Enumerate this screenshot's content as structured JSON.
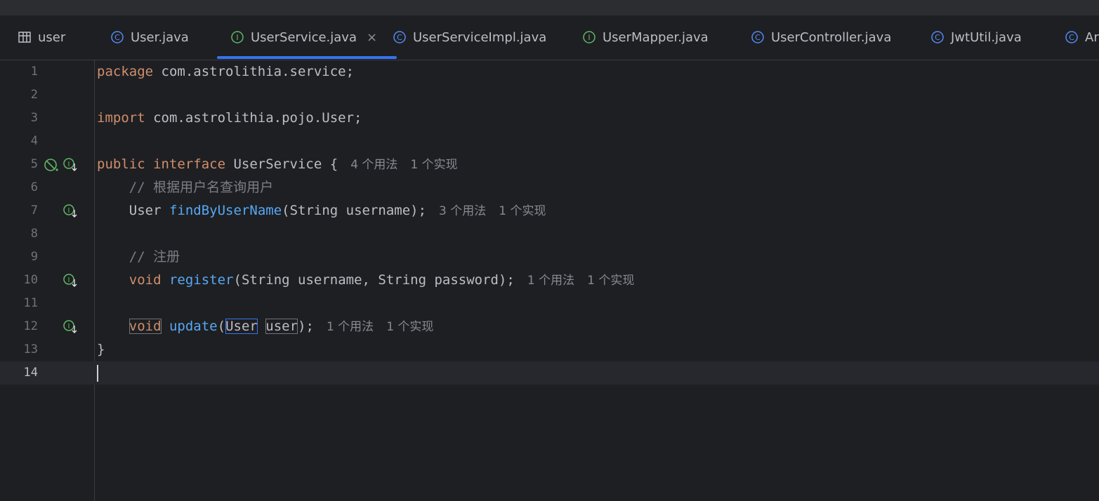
{
  "tabs": [
    {
      "label": "user",
      "icon": "table-icon",
      "active": false
    },
    {
      "label": "User.java",
      "icon": "class-icon",
      "active": false
    },
    {
      "label": "UserService.java",
      "icon": "interface-icon",
      "active": true
    },
    {
      "label": "UserServiceImpl.java",
      "icon": "class-icon",
      "active": false
    },
    {
      "label": "UserMapper.java",
      "icon": "interface-icon",
      "active": false
    },
    {
      "label": "UserController.java",
      "icon": "class-icon",
      "active": false
    },
    {
      "label": "JwtUtil.java",
      "icon": "class-icon",
      "active": false
    },
    {
      "label": "Ar",
      "icon": "class-icon",
      "active": false
    }
  ],
  "close_glyph": "×",
  "colors": {
    "keyword": "#cf8e6d",
    "function": "#56a8f5",
    "comment": "#7a7e85",
    "accent": "#3574f0",
    "interface_icon": "#5fb865",
    "class_icon": "#548af7"
  },
  "code": {
    "line1": {
      "n": "1",
      "kw": "package",
      "rest": " com.astrolithia.service;"
    },
    "line2": {
      "n": "2"
    },
    "line3": {
      "n": "3",
      "kw": "import",
      "rest": " com.astrolithia.pojo.User;"
    },
    "line4": {
      "n": "4"
    },
    "line5": {
      "n": "5",
      "kw1": "public",
      "kw2": "interface",
      "rest": " UserService {",
      "hint_usages": "4 个用法",
      "hint_impls": "1 个实现"
    },
    "line6": {
      "n": "6",
      "comment": "// 根据用户名查询用户"
    },
    "line7": {
      "n": "7",
      "type": "User",
      "fn": "findByUserName",
      "rest": "(String username);",
      "hint_usages": "3 个用法",
      "hint_impls": "1 个实现"
    },
    "line8": {
      "n": "8"
    },
    "line9": {
      "n": "9",
      "comment": "// 注册"
    },
    "line10": {
      "n": "10",
      "kw": "void",
      "fn": "register",
      "rest": "(String username, String password);",
      "hint_usages": "1 个用法",
      "hint_impls": "1 个实现"
    },
    "line11": {
      "n": "11"
    },
    "line12": {
      "n": "12",
      "kw": "void",
      "fn": "update",
      "open": "(",
      "type": "User",
      "param": "user",
      "close": ");",
      "hint_usages": "1 个用法",
      "hint_impls": "1 个实现"
    },
    "line13": {
      "n": "13",
      "rest": "}"
    },
    "line14": {
      "n": "14"
    }
  }
}
